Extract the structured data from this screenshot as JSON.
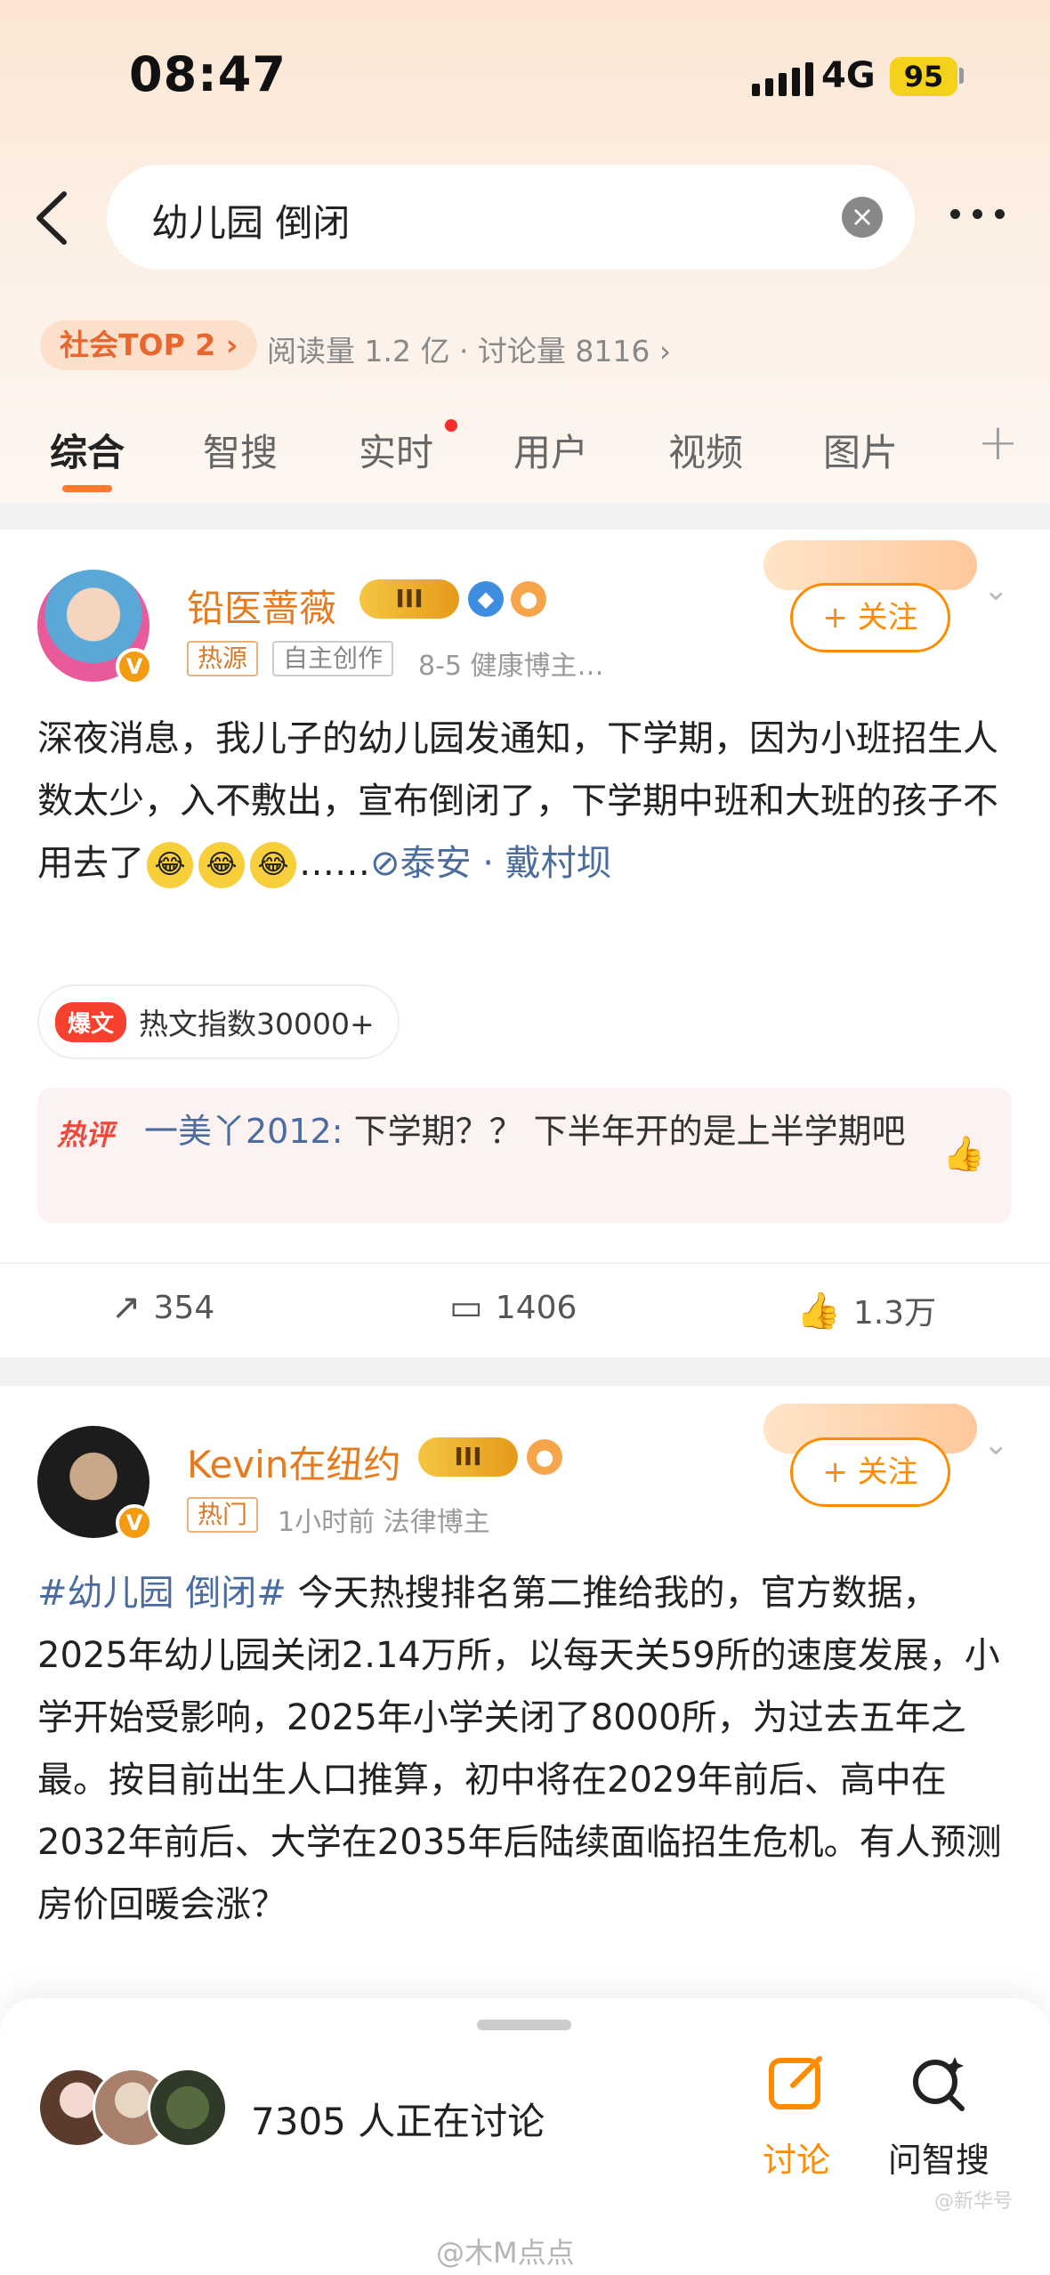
{
  "status_bar": {
    "time": "08:47",
    "network": "4G",
    "battery": "95"
  },
  "search": {
    "query": "幼儿园 倒闭"
  },
  "topic": {
    "badge": "社会TOP 2 ›",
    "stats": "阅读量 1.2 亿 · 讨论量 8116 ›"
  },
  "tabs": [
    {
      "label": "综合"
    },
    {
      "label": "智搜"
    },
    {
      "label": "实时"
    },
    {
      "label": "用户"
    },
    {
      "label": "视频"
    },
    {
      "label": "图片"
    }
  ],
  "tab_plus": "+",
  "posts": [
    {
      "username": "铅医蔷薇",
      "level": "III",
      "tags": [
        "热源",
        "自主创作"
      ],
      "meta": "8-5  健康博主…",
      "follow_label": "+ 关注",
      "text": "深夜消息，我儿子的幼儿园发通知，下学期，因为小班招生人数太少，入不敷出，宣布倒闭了，下学期中班和大班的孩子不用去了",
      "ellipsis": "……",
      "location": "泰安 · 戴村坝",
      "hot_index": {
        "label": "爆文",
        "text": "热文指数30000+"
      },
      "hot_comment": {
        "label": "热评",
        "user": "一美丫2012:",
        "text": " 下学期？？ 下半年开的是上半学期吧"
      },
      "actions": {
        "repost": "354",
        "comment": "1406",
        "like": "1.3万"
      }
    },
    {
      "username": "Kevin在纽约",
      "level": "III",
      "tags": [
        "热门"
      ],
      "meta": "1小时前  法律博主",
      "follow_label": "+ 关注",
      "hashtag": "#幼儿园 倒闭#",
      "text": " 今天热搜排名第二推给我的，官方数据，2025年幼儿园关闭2.14万所，以每天关59所的速度发展，小学开始受影响，2025年小学关闭了8000所，为过去五年之最。按目前出生人口推算，初中将在2029年前后、高中在2032年前后、大学在2035年后陆续面临招生危机。有人预测房价回暖会涨？"
    }
  ],
  "bottom": {
    "discussing": "7305 人正在讨论",
    "discuss_label": "讨论",
    "ask_label": "问智搜"
  },
  "watermark": "@木M点点",
  "watermark2": "@新华号",
  "colors": {
    "accent": "#ff8c00",
    "link": "#4a6c9f",
    "username": "#e57a1f"
  }
}
